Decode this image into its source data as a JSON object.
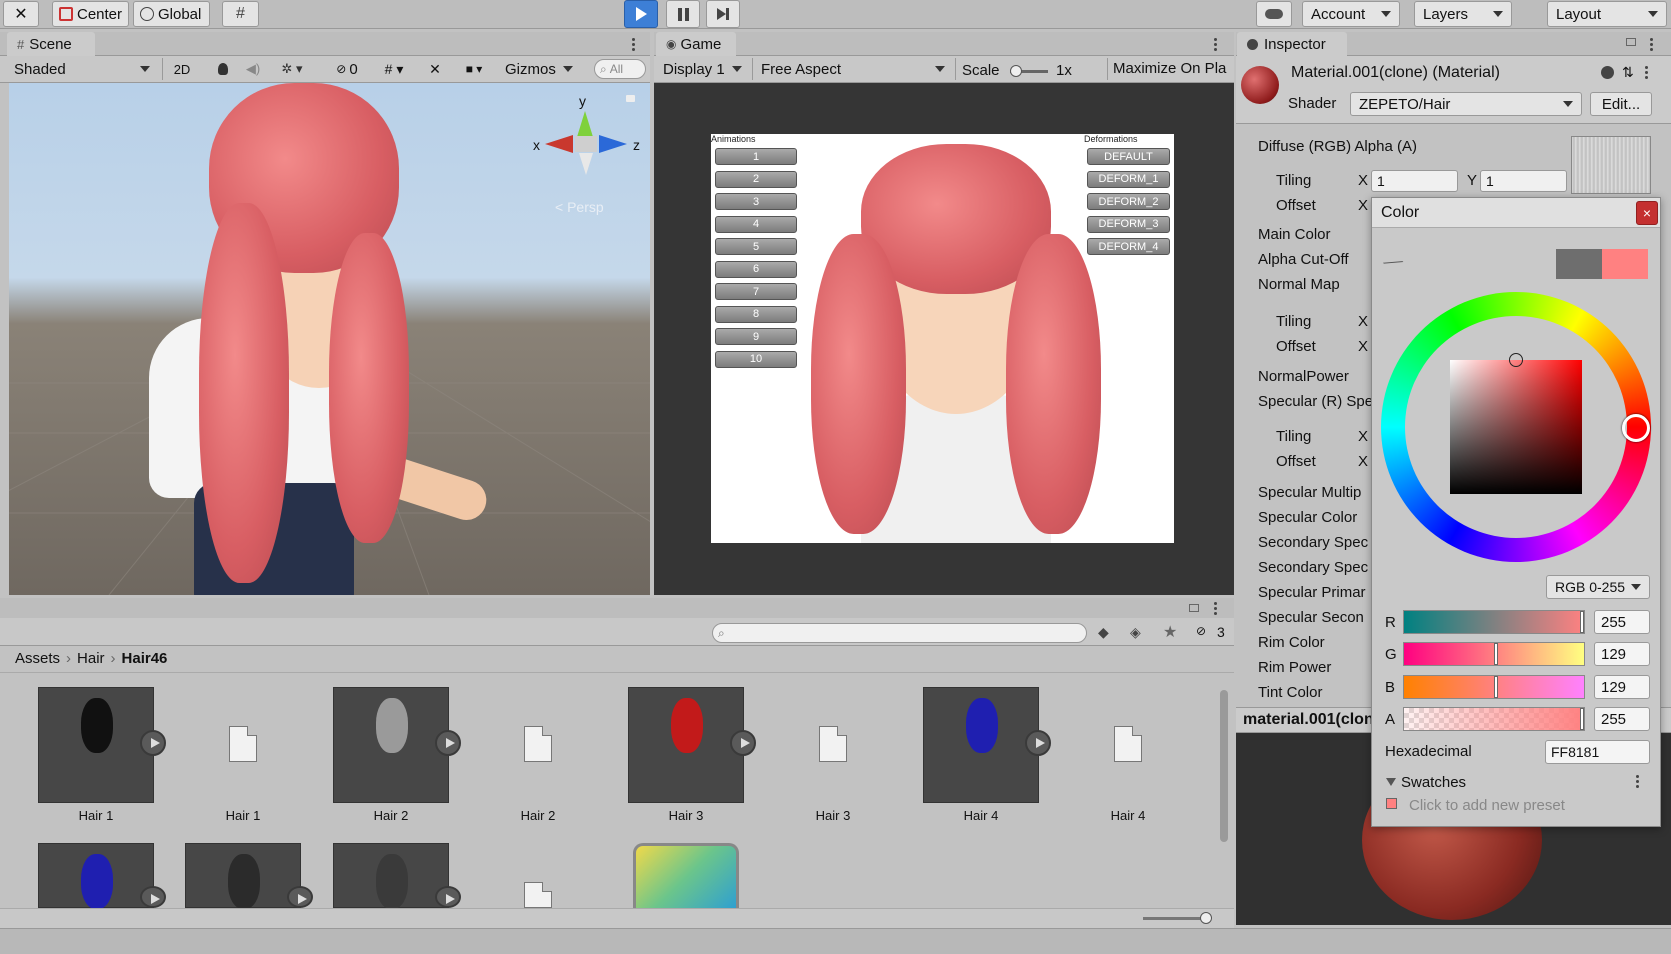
{
  "toolbar": {
    "pivot_label": "Center",
    "space_label": "Global",
    "account_label": "Account",
    "layers_label": "Layers",
    "layout_label": "Layout"
  },
  "scene": {
    "tab_label": "Scene",
    "shading_mode": "Shaded",
    "btn_2d": "2D",
    "hidden_count": "0",
    "gizmos_label": "Gizmos",
    "search_placeholder": "All",
    "gizmo_y": "y",
    "gizmo_x": "x",
    "gizmo_z": "z",
    "persp_label": "< Persp"
  },
  "game": {
    "tab_label": "Game",
    "display_label": "Display 1",
    "aspect_label": "Free Aspect",
    "scale_label": "Scale",
    "scale_value": "1x",
    "maximize_label": "Maximize On Pla",
    "animations_header": "Animations",
    "deformations_header": "Deformations",
    "animation_buttons": [
      "1",
      "2",
      "3",
      "4",
      "5",
      "6",
      "7",
      "8",
      "9",
      "10"
    ],
    "deform_buttons": [
      "DEFAULT",
      "DEFORM_1",
      "DEFORM_2",
      "DEFORM_3",
      "DEFORM_4"
    ]
  },
  "inspector": {
    "tab_label": "Inspector",
    "material_title": "Material.001(clone) (Material)",
    "shader_label": "Shader",
    "shader_value": "ZEPETO/Hair",
    "edit_label": "Edit...",
    "diffuse_label": "Diffuse (RGB) Alpha (A)",
    "tiling_label": "Tiling",
    "offset_label": "Offset",
    "x_label": "X",
    "y_label": "Y",
    "tiling_x": "1",
    "tiling_y": "1",
    "props": [
      "Main Color",
      "Alpha Cut-Off",
      "Normal Map",
      "NormalPower",
      "Specular (R) Spe",
      "Specular Multip",
      "Specular Color",
      "Secondary Spec",
      "Secondary Spec",
      "Specular Primar",
      "Specular Secon",
      "Rim Color",
      "Rim Power",
      "Tint Color"
    ],
    "preview_label": "material.001(clon"
  },
  "color_picker": {
    "title": "Color",
    "mode": "RGB 0-255",
    "r_label": "R",
    "r_value": "255",
    "g_label": "G",
    "g_value": "129",
    "b_label": "B",
    "b_value": "129",
    "a_label": "A",
    "a_value": "255",
    "hex_label": "Hexadecimal",
    "hex_value": "FF8181",
    "swatches_label": "Swatches",
    "add_preset": "Click to add new preset",
    "current_color": "#ff8181",
    "previous_color": "#6e6e6e"
  },
  "project": {
    "breadcrumb": [
      "Assets",
      "Hair",
      "Hair46"
    ],
    "hidden_count": "3",
    "assets_row1": [
      "Hair 1",
      "Hair 1",
      "Hair 2",
      "Hair 2",
      "Hair 3",
      "Hair 3",
      "Hair 4",
      "Hair 4"
    ]
  },
  "icons": [
    "tools-icon",
    "cloud-icon",
    "play-icon",
    "pause-icon",
    "step-icon",
    "eyedropper-icon",
    "lock-icon",
    "search-icon"
  ]
}
